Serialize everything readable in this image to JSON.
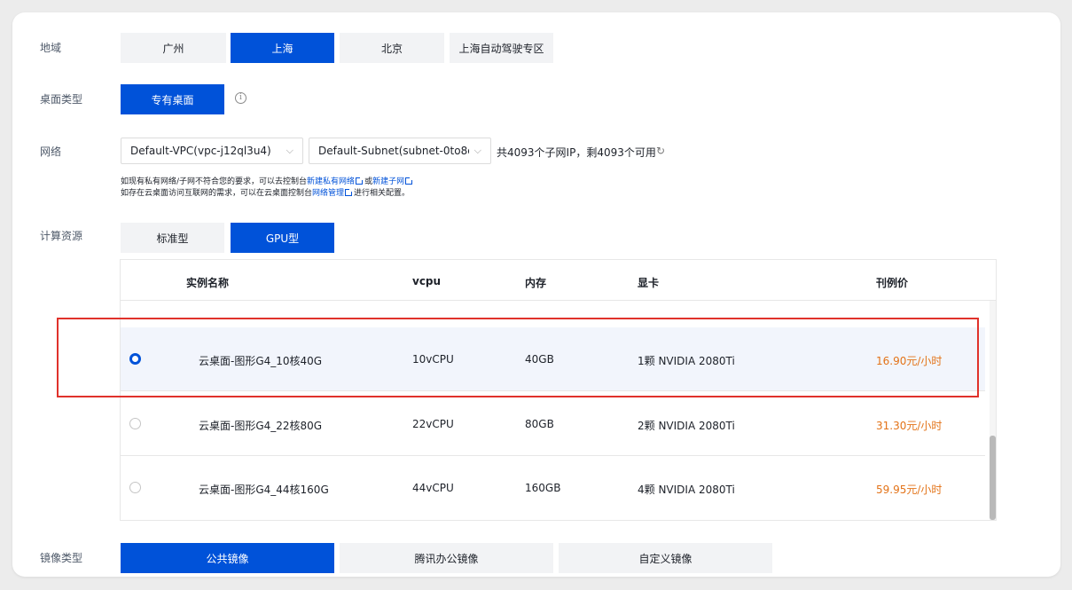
{
  "region": {
    "label": "地域",
    "options": [
      "广州",
      "上海",
      "北京",
      "上海自动驾驶专区"
    ],
    "selected": "上海"
  },
  "desktop_type": {
    "label": "桌面类型",
    "option": "专有桌面",
    "info_icon": "info-circle-icon"
  },
  "network": {
    "label": "网络",
    "vpc": "Default-VPC(vpc-j12ql3u4)",
    "subnet": "Default-Subnet(subnet-0to8q...",
    "ip_status": "共4093个子网IP，剩4093个可用",
    "refresh_icon": "refresh-icon",
    "hint1_prefix": "如现有私有网络/子网不符合您的要求，可以去控制台",
    "hint1_link1": "新建私有网络",
    "hint1_mid": "或",
    "hint1_link2": "新建子网",
    "hint2_prefix": "如存在云桌面访问互联网的需求，可以在云桌面控制台",
    "hint2_link": "网络管理",
    "hint2_suffix": "进行相关配置。"
  },
  "compute": {
    "label": "计算资源",
    "tabs": [
      "标准型",
      "GPU型"
    ],
    "selected": "GPU型"
  },
  "table": {
    "headers": [
      "实例名称",
      "vcpu",
      "内存",
      "显卡",
      "刊例价"
    ],
    "rows": [
      {
        "name": "云桌面-图形G4_10核40G",
        "vcpu": "10vCPU",
        "memory": "40GB",
        "gpu": "1颗 NVIDIA 2080Ti",
        "price": "16.90元/小时",
        "selected": true
      },
      {
        "name": "云桌面-图形G4_22核80G",
        "vcpu": "22vCPU",
        "memory": "80GB",
        "gpu": "2颗 NVIDIA 2080Ti",
        "price": "31.30元/小时",
        "selected": false
      },
      {
        "name": "云桌面-图形G4_44核160G",
        "vcpu": "44vCPU",
        "memory": "160GB",
        "gpu": "4颗 NVIDIA 2080Ti",
        "price": "59.95元/小时",
        "selected": false
      }
    ]
  },
  "image_type": {
    "label": "镜像类型",
    "options": [
      "公共镜像",
      "腾讯办公镜像",
      "自定义镜像"
    ],
    "selected": "公共镜像"
  },
  "colors": {
    "primary": "#0052d9",
    "price": "#e37318",
    "highlight": "#e0322b"
  }
}
